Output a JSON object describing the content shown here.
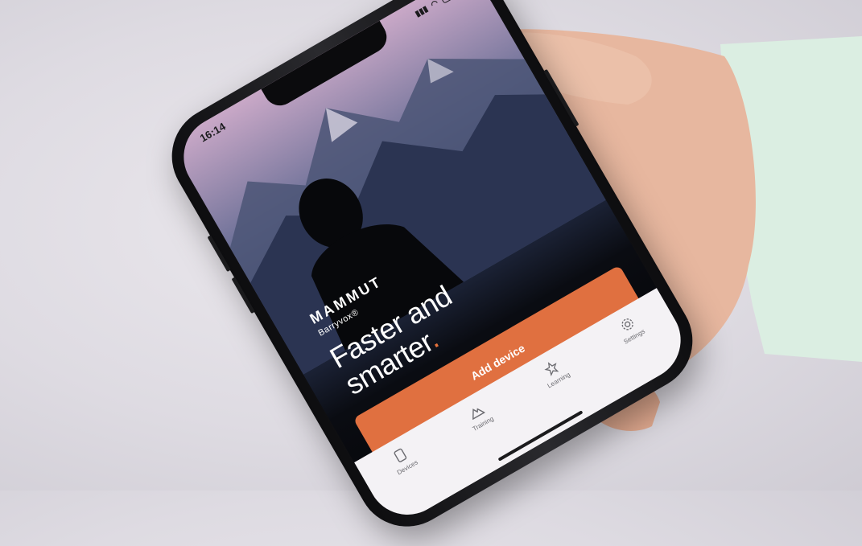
{
  "status_bar": {
    "time": "16:14",
    "battery": "85"
  },
  "brand": {
    "logo": "MAMMUT",
    "product": "Barryvox®"
  },
  "headline": {
    "line1": "Faster and",
    "line2": "smarter",
    "dot": "."
  },
  "cta": {
    "label": "Add device"
  },
  "tabbar": {
    "items": [
      {
        "label": "Devices",
        "icon": "device-icon"
      },
      {
        "label": "Training",
        "icon": "mountain-icon"
      },
      {
        "label": "Learning",
        "icon": "star-icon"
      },
      {
        "label": "Settings",
        "icon": "gear-icon"
      }
    ]
  },
  "colors": {
    "accent": "#e07040",
    "background": "#dedbe2",
    "skin": "#e9b9a1",
    "sleeve": "#dbeee2"
  }
}
